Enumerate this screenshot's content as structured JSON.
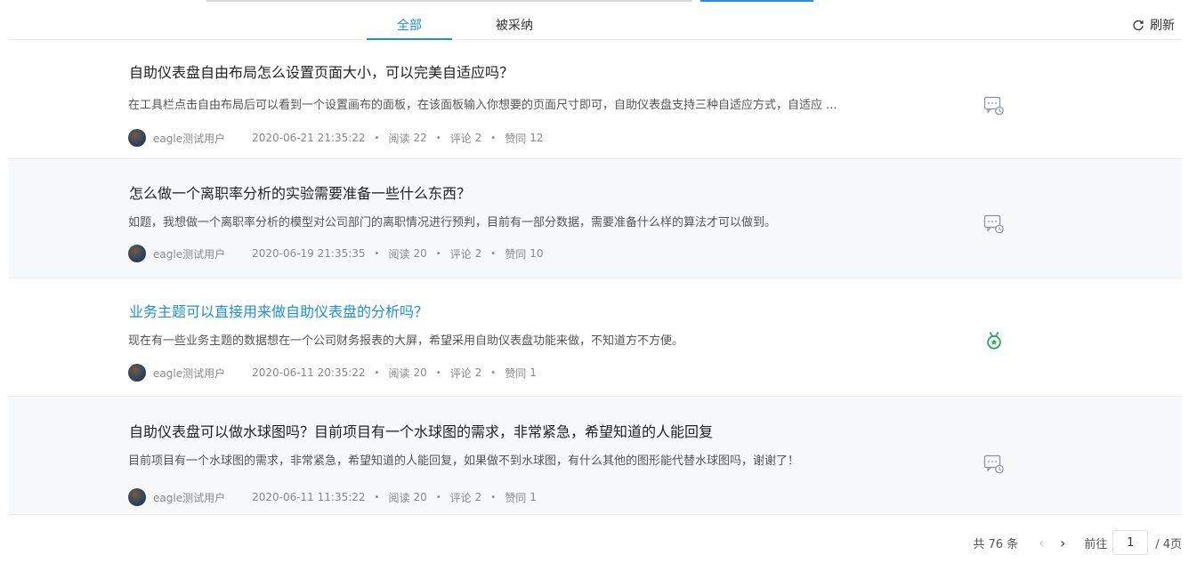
{
  "tabs": {
    "all": "全部",
    "adopted": "被采纳",
    "refresh": "刷新"
  },
  "questions": [
    {
      "title": "自助仪表盘自由布局怎么设置页面大小，可以完美自适应吗？",
      "desc": "在工具栏点击自由布局后可以看到一个设置画布的面板，在该面板输入你想要的页面尺寸即可，自助仪表盘支持三种自适应方式，自适应 ...",
      "author": "eagle测试用户",
      "time": "2020-06-21 21:35:22",
      "read_label": "阅读",
      "read": "22",
      "comment_label": "评论",
      "comment": "2",
      "like_label": "赞同",
      "like": "12",
      "status_icon": "pending-chat-icon"
    },
    {
      "title": "怎么做一个离职率分析的实验需要准备一些什么东西？",
      "desc": "如题，我想做一个离职率分析的模型对公司部门的离职情况进行预判，目前有一部分数据，需要准备什么样的算法才可以做到。",
      "author": "eagle测试用户",
      "time": "2020-06-19 21:35:35",
      "read_label": "阅读",
      "read": "20",
      "comment_label": "评论",
      "comment": "2",
      "like_label": "赞同",
      "like": "10",
      "status_icon": "pending-chat-icon"
    },
    {
      "title": "业务主题可以直接用来做自助仪表盘的分析吗？",
      "desc": "现在有一些业务主题的数据想在一个公司财务报表的大屏，希望采用自助仪表盘功能来做，不知道方不方便。",
      "author": "eagle测试用户",
      "time": "2020-06-11 20:35:22",
      "read_label": "阅读",
      "read": "20",
      "comment_label": "评论",
      "comment": "2",
      "like_label": "赞同",
      "like": "1",
      "status_icon": "adopted-medal-icon"
    },
    {
      "title": "自助仪表盘可以做水球图吗？目前项目有一个水球图的需求，非常紧急，希望知道的人能回复",
      "desc": "目前项目有一个水球图的需求，非常紧急，希望知道的人能回复，如果做不到水球图，有什么其他的图形能代替水球图吗，谢谢了！",
      "author": "eagle测试用户",
      "time": "2020-06-11 11:35:22",
      "read_label": "阅读",
      "read": "20",
      "comment_label": "评论",
      "comment": "2",
      "like_label": "赞同",
      "like": "1",
      "status_icon": "pending-chat-icon"
    }
  ],
  "pagination": {
    "total": "共 76 条",
    "goto_label": "前往",
    "current_page": "1",
    "total_pages": "/ 4页"
  },
  "colors": {
    "accent": "#1e8fd8",
    "adopted": "#2aa860",
    "alt_row": "#f7f8fa"
  }
}
